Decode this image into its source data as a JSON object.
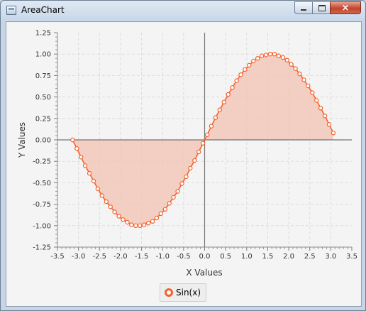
{
  "window": {
    "title": "AreaChart",
    "close_glyph": "×"
  },
  "icons": {
    "app": "window-app-icon",
    "minimize": "minimize-icon",
    "maximize": "maximize-icon",
    "close": "close-icon"
  },
  "colors": {
    "series": "#f3622d",
    "fill": "#f3c3b3"
  },
  "chart_data": {
    "type": "area",
    "xlabel": "X Values",
    "ylabel": "Y Values",
    "xlim": [
      -3.5,
      3.5
    ],
    "ylim": [
      -1.25,
      1.25
    ],
    "x_ticks": [
      "-3.5",
      "-3.0",
      "-2.5",
      "-2.0",
      "-1.5",
      "-1.0",
      "-0.5",
      "0.0",
      "0.5",
      "1.0",
      "1.5",
      "2.0",
      "2.5",
      "3.0",
      "3.5"
    ],
    "y_ticks": [
      "1.25",
      "1.00",
      "0.75",
      "0.50",
      "0.25",
      "0.00",
      "-0.25",
      "-0.50",
      "-0.75",
      "-1.00",
      "-1.25"
    ],
    "grid": true,
    "legend_position": "bottom",
    "series": [
      {
        "name": "Sin(x)",
        "x": [
          -3.14,
          -3.04,
          -2.94,
          -2.84,
          -2.74,
          -2.64,
          -2.54,
          -2.44,
          -2.34,
          -2.24,
          -2.14,
          -2.04,
          -1.94,
          -1.84,
          -1.74,
          -1.64,
          -1.54,
          -1.44,
          -1.34,
          -1.24,
          -1.14,
          -1.04,
          -0.94,
          -0.84,
          -0.74,
          -0.64,
          -0.54,
          -0.44,
          -0.34,
          -0.24,
          -0.14,
          -0.04,
          0.06,
          0.16,
          0.26,
          0.36,
          0.46,
          0.56,
          0.66,
          0.76,
          0.86,
          0.96,
          1.06,
          1.16,
          1.26,
          1.36,
          1.46,
          1.56,
          1.66,
          1.76,
          1.86,
          1.96,
          2.06,
          2.16,
          2.26,
          2.36,
          2.46,
          2.56,
          2.66,
          2.76,
          2.86,
          2.96,
          3.06
        ],
        "y": [
          0.0,
          -0.1,
          -0.2,
          -0.3,
          -0.39,
          -0.48,
          -0.57,
          -0.65,
          -0.72,
          -0.78,
          -0.84,
          -0.89,
          -0.93,
          -0.96,
          -0.99,
          -1.0,
          -1.0,
          -0.99,
          -0.97,
          -0.95,
          -0.91,
          -0.86,
          -0.81,
          -0.74,
          -0.67,
          -0.6,
          -0.51,
          -0.43,
          -0.33,
          -0.24,
          -0.14,
          -0.04,
          0.06,
          0.16,
          0.26,
          0.35,
          0.44,
          0.53,
          0.61,
          0.69,
          0.76,
          0.82,
          0.87,
          0.92,
          0.95,
          0.98,
          0.99,
          1.0,
          1.0,
          0.98,
          0.96,
          0.93,
          0.88,
          0.83,
          0.77,
          0.7,
          0.63,
          0.55,
          0.46,
          0.37,
          0.28,
          0.18,
          0.08
        ]
      }
    ]
  }
}
